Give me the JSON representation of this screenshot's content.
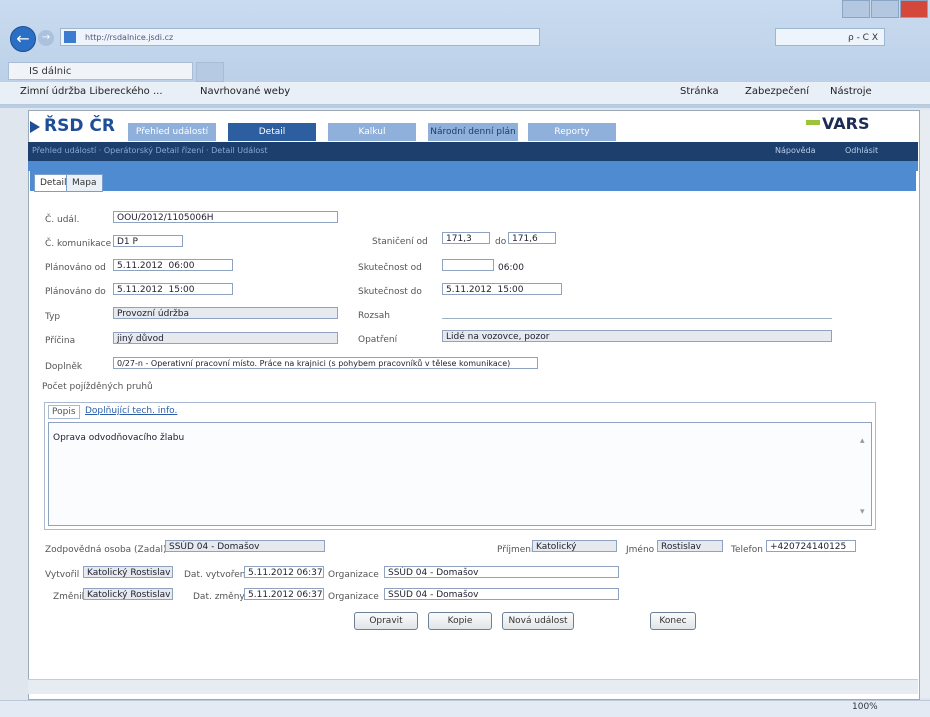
{
  "browser": {
    "address_prefix": "http://",
    "address_host": "rsdalnice.jsdi.cz",
    "tab_title": "IS dálnic",
    "address_right": "ρ - C X",
    "favorites": [
      "Zimní údržba Libereckého ...",
      "Navrhované weby"
    ],
    "toolbar": [
      "Stránka",
      "Zabezpečení",
      "Nástroje"
    ],
    "zoom": "100%"
  },
  "app": {
    "logo": "ŘSD ČR",
    "brand": "VARS",
    "nav_tabs": [
      "Přehled událostí",
      "Detail",
      "Kalkul",
      "Národní denní plán",
      "Reporty"
    ],
    "breadcrumb": "Přehled událostí · Operátorský Detail řízení · Detail Událost",
    "breadcrumb_right": [
      "Nápověda",
      "Odhlásit"
    ]
  },
  "subtabs": [
    "Detail",
    "Mapa"
  ],
  "form": {
    "labels": {
      "cislo": "Č. udál.",
      "komunikace": "Č. komunikace",
      "planovano_od": "Plánováno od",
      "planovano_do": "Plánováno do",
      "typ": "Typ",
      "pricina": "Příčina",
      "doplnek": "Doplněk",
      "pocet_pruhu": "Počet pojížděných pruhů",
      "staniceni_od": "Staničení od",
      "do": "do",
      "skutecnost_od": "Skutečnost od",
      "skutecnost_do": "Skutečnost do",
      "rozsah": "Rozsah",
      "opatreni": "Opatření"
    },
    "values": {
      "cislo": "OOU/2012/1105006H",
      "komunikace": "D1 P",
      "planovano_od_date": "5.11.2012",
      "planovano_od_time": "06:00",
      "planovano_do_date": "5.11.2012",
      "planovano_do_time": "15:00",
      "typ": "Provozní údržba",
      "pricina": "jiný důvod",
      "doplnek": "0/27-n - Operativní pracovní místo. Práce na krajnici (s pohybem pracovníků v tělese komunikace)",
      "staniceni_od": "171,3",
      "staniceni_do": "171,6",
      "skutecnost_od_time": "06:00",
      "skutecnost_do_date": "5.11.2012",
      "skutecnost_do_time": "15:00",
      "opatreni": "Lidé na vozovce, pozor"
    },
    "inner_tabs": [
      "Popis",
      "Doplňující tech. info."
    ],
    "description": "Oprava odvodňovacího žlabu"
  },
  "footer": {
    "labels": {
      "zodpovedna": "Zodpovědná osoba (Zadal)",
      "prijmeni": "Příjmení",
      "jmeno": "Jméno",
      "telefon": "Telefon",
      "vytvoril": "Vytvořil",
      "dat_vytvoreni": "Dat. vytvoření",
      "organizace": "Organizace",
      "zmenil": "Změnil",
      "dat_zmeny": "Dat. změny"
    },
    "values": {
      "zodpovedna": "SSÚD 04 - Domašov",
      "prijmeni": "Katolický",
      "jmeno": "Rostislav",
      "telefon": "+420724140125",
      "vytvoril": "Katolický Rostislav",
      "dat_vytvoreni": "5.11.2012 06:37",
      "organizace_1": "SSÚD 04 - Domašov",
      "zmenil": "Katolický Rostislav",
      "dat_zmeny": "5.11.2012 06:37",
      "organizace_2": "SSÚD 04 - Domašov"
    }
  },
  "buttons": [
    "Opravit",
    "Kopie",
    "Nová událost",
    "Konec"
  ],
  "colors": {
    "header_bar": "#1c3f6e",
    "panel": "#4f8bd0",
    "logo": "#1f4e99",
    "vars_accent": "#9dc33b"
  }
}
